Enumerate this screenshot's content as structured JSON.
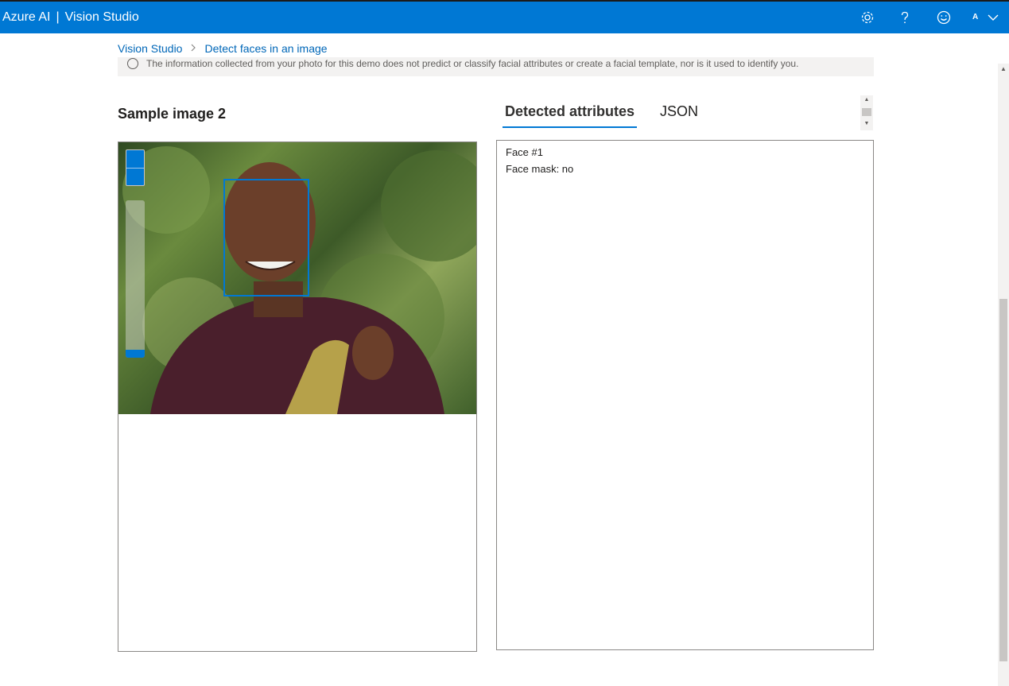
{
  "header": {
    "brand": "Azure AI",
    "separator": "|",
    "product": "Vision Studio",
    "account_initial": "A",
    "icons": [
      "settings-gear-icon",
      "help-icon",
      "feedback-smiley-icon",
      "chevron-down-icon"
    ]
  },
  "breadcrumb": {
    "home": "Vision Studio",
    "current": "Detect faces in an image"
  },
  "notice": {
    "text": "The information collected from your photo for this demo does not predict or classify facial attributes or create a facial template, nor is it used to identify you."
  },
  "sample": {
    "title": "Sample image 2"
  },
  "tabs": [
    {
      "label": "Detected attributes",
      "active": true
    },
    {
      "label": "JSON",
      "active": false
    }
  ],
  "results": {
    "face_label": "Face #1",
    "face_mask": "Face mask: no"
  },
  "colors": {
    "accent": "#0078d4",
    "header_bg": "#0078d4",
    "link": "#0067b8"
  }
}
